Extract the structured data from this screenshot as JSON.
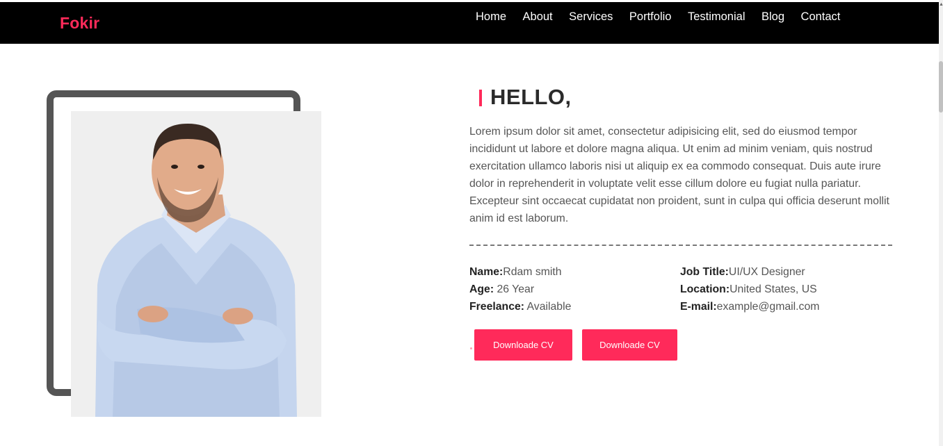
{
  "brand": "Fokir",
  "nav": [
    "Home",
    "About",
    "Services",
    "Portfolio",
    "Testimonial",
    "Blog",
    "Contact"
  ],
  "hero": {
    "heading": "HELLO,",
    "intro": "Lorem ipsum dolor sit amet, consectetur adipisicing elit, sed do eiusmod tempor incididunt ut labore et dolore magna aliqua. Ut enim ad minim veniam, quis nostrud exercitation ullamco laboris nisi ut aliquip ex ea commodo consequat. Duis aute irure dolor in reprehenderit in voluptate velit esse cillum dolore eu fugiat nulla pariatur. Excepteur sint occaecat cupidatat non proident, sunt in culpa qui officia deserunt mollit anim id est laborum."
  },
  "info_left": [
    {
      "label": "Name:",
      "value": "Rdam smith"
    },
    {
      "label": "Age:",
      "value": " 26 Year"
    },
    {
      "label": "Freelance:",
      "value": " Available"
    }
  ],
  "info_right": [
    {
      "label": "Job Title:",
      "value": "UI/UX Designer"
    },
    {
      "label": "Location:",
      "value": "United States, US"
    },
    {
      "label": "E-mail:",
      "value": "example@gmail.com"
    }
  ],
  "buttons": [
    "Downloade CV",
    "Downloade CV"
  ],
  "colors": {
    "accent": "#ff2a5a",
    "navbar": "#000000",
    "frame": "#555555"
  },
  "icons": {
    "scroll_up": "scroll-up-arrow-icon"
  }
}
